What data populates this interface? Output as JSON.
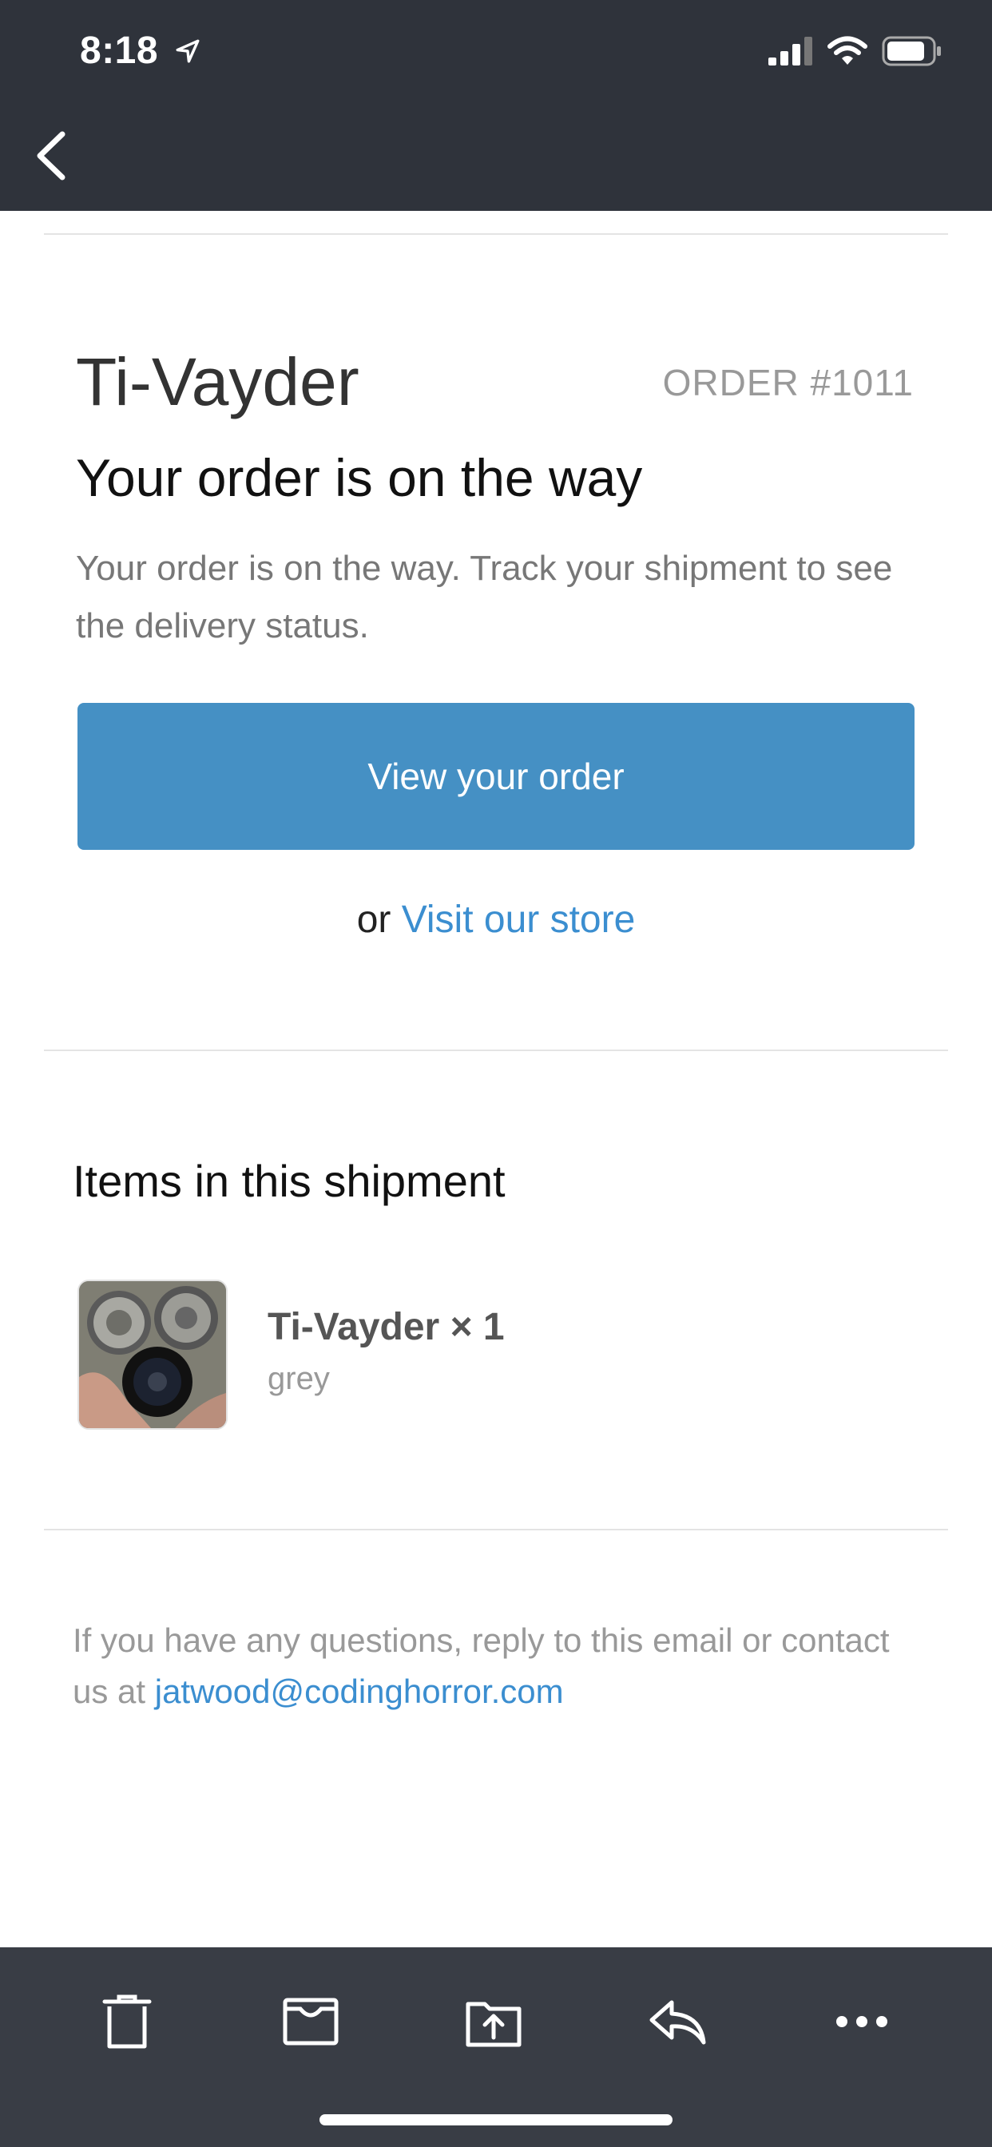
{
  "status_bar": {
    "time": "8:18",
    "location_icon": "location-arrow-icon"
  },
  "nav": {
    "back_icon": "chevron-left-icon"
  },
  "email": {
    "shop_name": "Ti-Vayder",
    "order_number": "ORDER #1011",
    "headline": "Your order is on the way",
    "body": "Your order is on the way. Track your shipment to see the delivery status.",
    "view_order_label": "View your order",
    "or_text": "or",
    "visit_store_label": "Visit our store",
    "items_section_title": "Items in this shipment",
    "items": [
      {
        "title": "Ti-Vayder × 1",
        "variant": "grey"
      }
    ],
    "footer_text": "If you have any questions, reply to this email or contact us at",
    "contact_email": "jatwood@codinghorror.com"
  },
  "toolbar": {
    "buttons": [
      "trash-icon",
      "archive-icon",
      "move-to-folder-icon",
      "reply-icon",
      "more-icon"
    ]
  },
  "colors": {
    "bar_bg": "#2f333b",
    "toolbar_bg": "#393d45",
    "accent_button": "#4590c4",
    "link": "#3b8ed0"
  }
}
